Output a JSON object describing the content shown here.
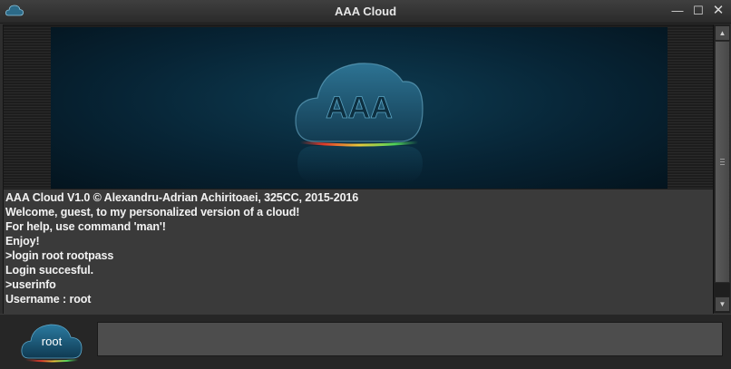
{
  "window": {
    "title": "AAA Cloud",
    "controls": {
      "minimize": "—",
      "maximize": "☐",
      "close": "✕"
    }
  },
  "banner": {
    "logo_text": "AAA",
    "icon": "cloud-logo-icon",
    "colors": {
      "background": "#072435",
      "cloud": "#1d5670",
      "glow_red": "#e03a2a",
      "glow_yellow": "#e8c93a",
      "glow_green": "#4fd15a"
    }
  },
  "console": {
    "lines": [
      "AAA Cloud V1.0 © Alexandru-Adrian Achiritoaei, 325CC, 2015-2016",
      "Welcome, guest, to my personalized version of a cloud!",
      "For help, use command 'man'!",
      "Enjoy!",
      ">login root rootpass",
      "Login succesful.",
      ">userinfo",
      "Username : root"
    ]
  },
  "scrollbar": {
    "up_icon": "▲",
    "down_icon": "▼"
  },
  "bottom": {
    "user_label": "root",
    "command_value": ""
  }
}
